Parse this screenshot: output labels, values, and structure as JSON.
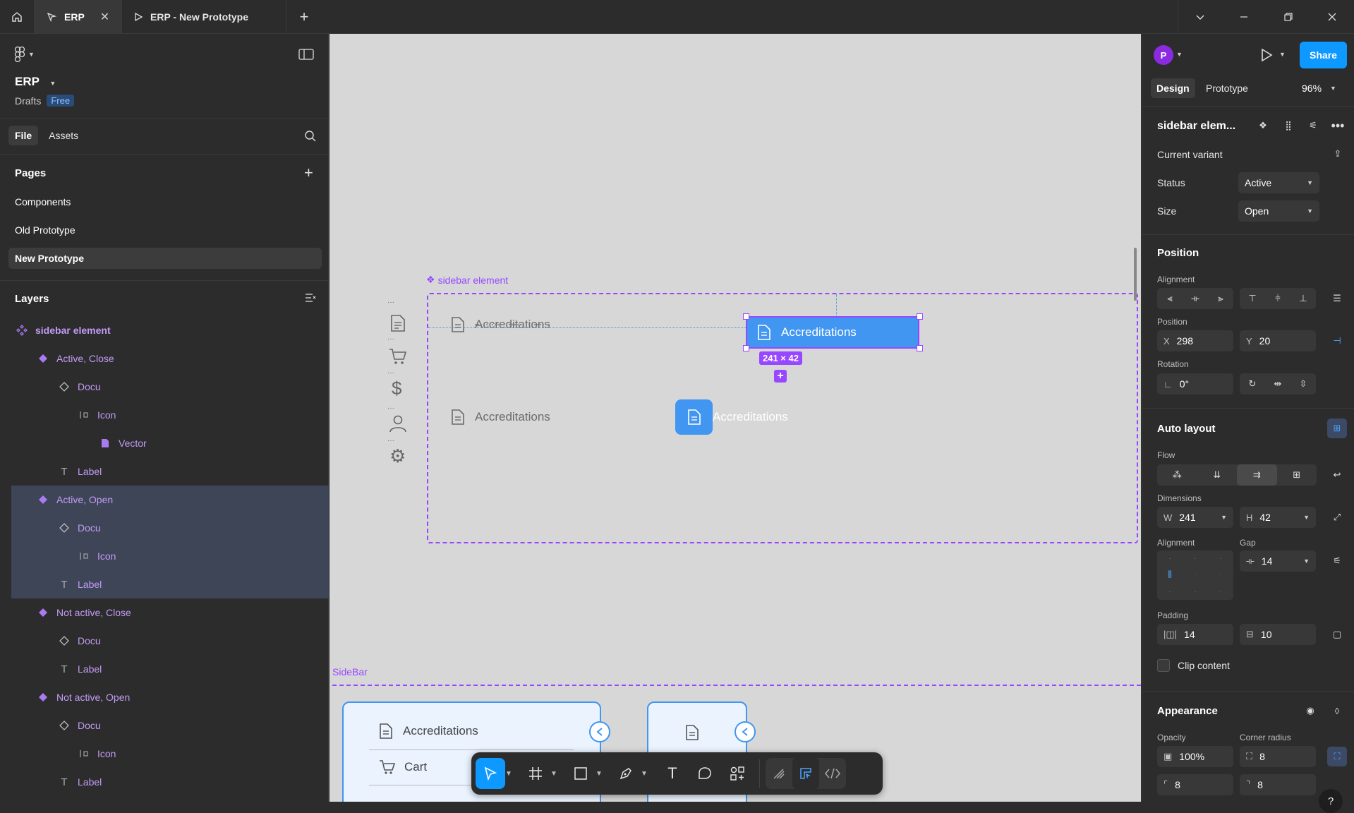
{
  "tabs": [
    {
      "label": "ERP"
    },
    {
      "label": "ERP - New Prototype"
    }
  ],
  "file": {
    "name": "ERP",
    "location": "Drafts",
    "plan": "Free"
  },
  "left_tabs": {
    "file": "File",
    "assets": "Assets"
  },
  "pages": {
    "title": "Pages",
    "items": [
      "Components",
      "Old Prototype",
      "New Prototype"
    ]
  },
  "layers": {
    "title": "Layers",
    "items": [
      {
        "label": "sidebar element",
        "icon": "component-set-icon"
      },
      {
        "label": "Active, Close",
        "icon": "variant-icon"
      },
      {
        "label": "Docu",
        "icon": "instance-icon"
      },
      {
        "label": "Icon",
        "icon": "frame-icon"
      },
      {
        "label": "Vector",
        "icon": "vector-icon"
      },
      {
        "label": "Label",
        "icon": "text-icon"
      },
      {
        "label": "Active, Open",
        "icon": "variant-icon"
      },
      {
        "label": "Docu",
        "icon": "instance-icon"
      },
      {
        "label": "Icon",
        "icon": "frame-icon"
      },
      {
        "label": "Label",
        "icon": "text-icon"
      },
      {
        "label": "Not active, Close",
        "icon": "variant-icon"
      },
      {
        "label": "Docu",
        "icon": "instance-icon"
      },
      {
        "label": "Label",
        "icon": "text-icon"
      },
      {
        "label": "Not active, Open",
        "icon": "variant-icon"
      },
      {
        "label": "Docu",
        "icon": "instance-icon"
      },
      {
        "label": "Icon",
        "icon": "frame-icon"
      },
      {
        "label": "Label",
        "icon": "text-icon"
      }
    ]
  },
  "canvas": {
    "component_label": "sidebar element",
    "item_label": "Accreditations",
    "size_badge": "241 × 42",
    "frame_label": "SideBar",
    "sidebar_items": [
      "Accreditations",
      "Cart"
    ]
  },
  "right": {
    "avatar": "P",
    "share": "Share",
    "tab_design": "Design",
    "tab_prototype": "Prototype",
    "zoom": "96%",
    "component_name": "sidebar elem...",
    "current_variant": "Current variant",
    "status_label": "Status",
    "status_value": "Active",
    "size_label": "Size",
    "size_value": "Open",
    "position_title": "Position",
    "alignment_label": "Alignment",
    "position_label": "Position",
    "x_label": "X",
    "x_value": "298",
    "y_label": "Y",
    "y_value": "20",
    "rotation_label": "Rotation",
    "rotation_value": "0°",
    "autolayout_title": "Auto layout",
    "flow_label": "Flow",
    "dimensions_label": "Dimensions",
    "w_label": "W",
    "w_value": "241",
    "h_label": "H",
    "h_value": "42",
    "al_alignment_label": "Alignment",
    "gap_label": "Gap",
    "gap_value": "14",
    "padding_label": "Padding",
    "padding_h": "14",
    "padding_v": "10",
    "clip_content": "Clip content",
    "appearance_title": "Appearance",
    "opacity_label": "Opacity",
    "opacity_value": "100%",
    "corner_label": "Corner radius",
    "corner_value": "8",
    "corner_tl": "8",
    "corner_tr": "8"
  },
  "colors": {
    "accent": "#0d99ff",
    "component": "#9747ff",
    "canvas": "#d7d7d7",
    "selection_item": "#4096f0"
  }
}
